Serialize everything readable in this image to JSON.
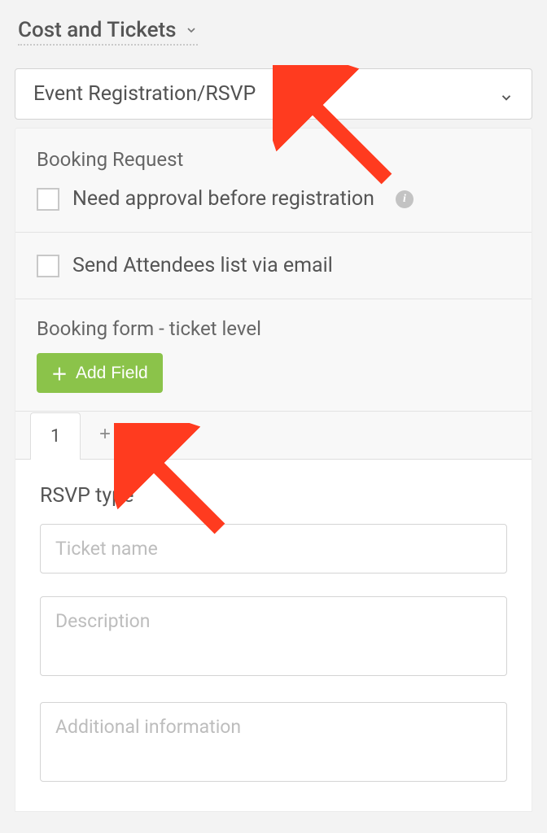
{
  "section_title": "Cost and Tickets",
  "type_select": {
    "selected": "Event Registration/RSVP"
  },
  "booking_request": {
    "heading": "Booking Request",
    "checkbox_label": "Need approval before registration"
  },
  "attendees": {
    "checkbox_label": "Send Attendees list via email"
  },
  "booking_form": {
    "heading": "Booking form - ticket level",
    "add_field_label": "Add Field"
  },
  "tabs": {
    "first": "1"
  },
  "ticket": {
    "rsvp_type_label": "RSVP type",
    "name_placeholder": "Ticket name",
    "description_placeholder": "Description",
    "additional_info_placeholder": "Additional information"
  },
  "annotation": {
    "color": "#ff3b1f"
  }
}
